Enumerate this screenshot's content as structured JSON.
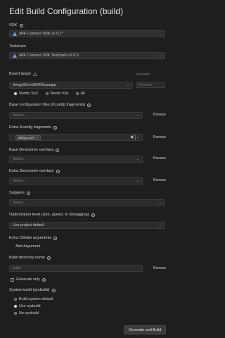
{
  "page": {
    "title": "Edit Build Configuration (build)"
  },
  "sdk": {
    "label": "SDK",
    "value": "nRF Connect SDK v2.9.1*"
  },
  "toolchain": {
    "label": "Toolchain",
    "value": "nRF Connect SDK Toolchain v2.8.0"
  },
  "board": {
    "label": "Board target",
    "value": "thingy91x/nrf5340/cpuapp",
    "revision_label": "Revision",
    "revision_placeholder": "Revision",
    "options": [
      "Nordic SoC",
      "Nordic Kits",
      "All"
    ]
  },
  "kconfig": {
    "label": "Base configuration files (Kconfig fragments)",
    "placeholder": "Select..."
  },
  "extra_kconfig": {
    "label": "Extra Kconfig fragments",
    "chip": "debug.conf",
    "chip_x": "×",
    "clear": "✕"
  },
  "devicetree": {
    "label": "Base Devicetree overlays",
    "placeholder": "Select..."
  },
  "extra_devicetree": {
    "label": "Extra Devicetree overlays",
    "placeholder": "Select..."
  },
  "snippets": {
    "label": "Snippets",
    "placeholder": "Select..."
  },
  "optimization": {
    "label": "Optimization level (size, speed, or debugging)",
    "value": "Use project default"
  },
  "cmake": {
    "label": "Extra CMake arguments",
    "add_label": "Add Argument"
  },
  "build_dir": {
    "label": "Build directory name",
    "value": "build"
  },
  "generate_only": {
    "label": "Generate only"
  },
  "sysbuild": {
    "label": "System build (sysbuild)",
    "options": [
      "Build system default",
      "Use sysbuild",
      "No sysbuild"
    ]
  },
  "actions": {
    "browse": "Browse",
    "submit": "Generate and Build"
  }
}
